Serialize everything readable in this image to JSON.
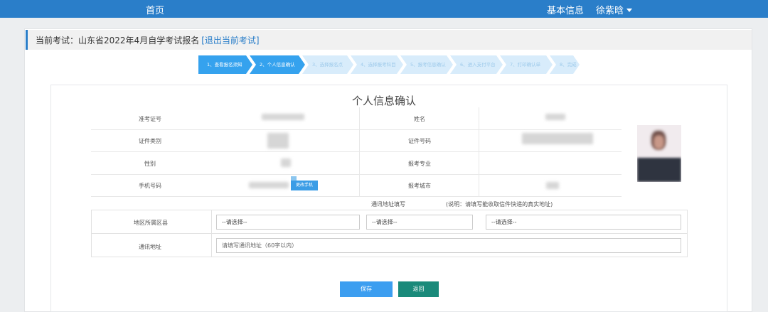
{
  "topbar": {
    "home_label": "首页",
    "basic_info_label": "基本信息",
    "user_name": "徐紫晗"
  },
  "exam_bar": {
    "prefix": "当前考试：",
    "exam_name": "山东省2022年4月自学考试报名",
    "exit_label": "[退出当前考试]"
  },
  "steps": [
    {
      "label": "1、查看报名须知",
      "state": "done"
    },
    {
      "label": "2、个人信息确认",
      "state": "active"
    },
    {
      "label": "3、选择报名点",
      "state": "todo"
    },
    {
      "label": "4、选择报考科目",
      "state": "todo"
    },
    {
      "label": "5、报考信息确认",
      "state": "todo"
    },
    {
      "label": "6、进入支付平台",
      "state": "todo"
    },
    {
      "label": "7、打印确认单",
      "state": "todo"
    },
    {
      "label": "8、完成",
      "state": "todo"
    }
  ],
  "form": {
    "title": "个人信息确认",
    "fields": {
      "admission_no": "准考证号",
      "name": "姓名",
      "id_type": "证件类别",
      "id_no": "证件号码",
      "gender": "性别",
      "major": "报考专业",
      "phone": "手机号码",
      "city": "报考城市"
    },
    "change_phone_label": "更改手机",
    "address_section_label": "通讯地址填写",
    "address_note": "(说明：请填写能收取信件快递的真实地址)",
    "region_label": "地区所属区县",
    "address_label": "通讯地址",
    "select_placeholder": "--请选择--",
    "address_placeholder": "请填写通讯地址（60字以内）"
  },
  "buttons": {
    "save": "保存",
    "back": "返回"
  },
  "colors": {
    "primary": "#2a7ec9",
    "step_active": "#35a2ee",
    "step_inactive": "#d8ecfb",
    "back_button": "#1a8a7a"
  }
}
